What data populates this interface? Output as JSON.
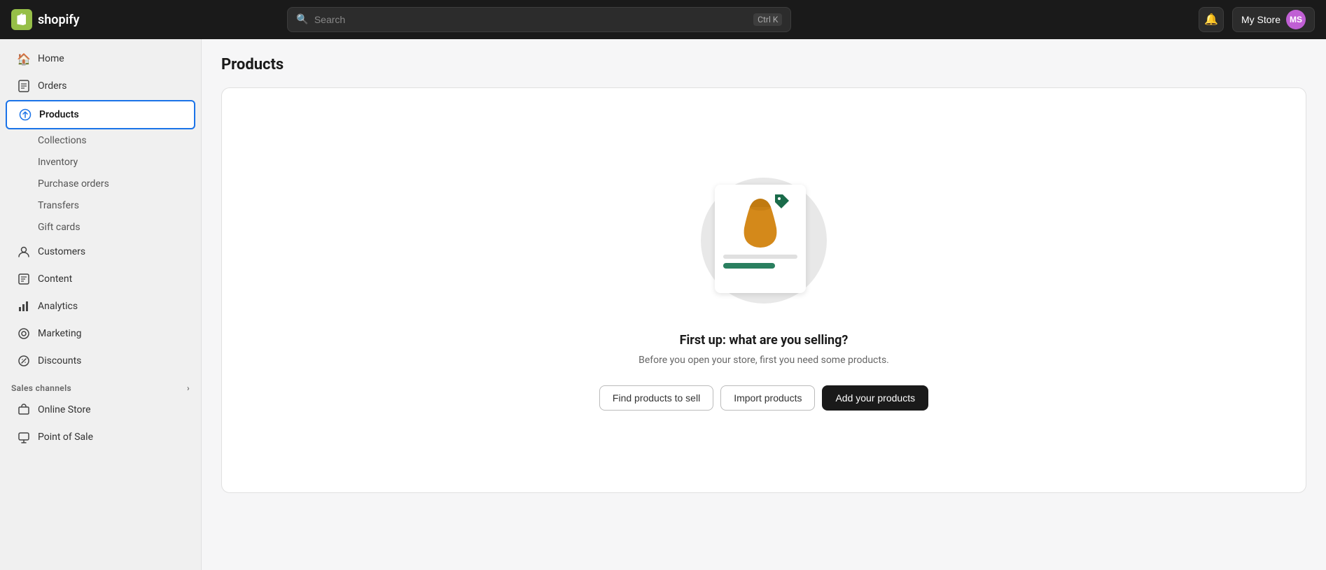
{
  "topnav": {
    "logo_text": "shopify",
    "search_placeholder": "Search",
    "search_shortcut": "Ctrl K",
    "bell_icon": "🔔",
    "store_name": "My Store",
    "avatar_initials": "MS"
  },
  "sidebar": {
    "nav_items": [
      {
        "id": "home",
        "label": "Home",
        "icon": "🏠"
      },
      {
        "id": "orders",
        "label": "Orders",
        "icon": "📋"
      },
      {
        "id": "products",
        "label": "Products",
        "icon": "🏷",
        "active": true
      }
    ],
    "sub_items": [
      {
        "id": "collections",
        "label": "Collections"
      },
      {
        "id": "inventory",
        "label": "Inventory"
      },
      {
        "id": "purchase-orders",
        "label": "Purchase orders"
      },
      {
        "id": "transfers",
        "label": "Transfers"
      },
      {
        "id": "gift-cards",
        "label": "Gift cards"
      }
    ],
    "more_items": [
      {
        "id": "customers",
        "label": "Customers",
        "icon": "👤"
      },
      {
        "id": "content",
        "label": "Content",
        "icon": "📄"
      },
      {
        "id": "analytics",
        "label": "Analytics",
        "icon": "📊"
      },
      {
        "id": "marketing",
        "label": "Marketing",
        "icon": "🎯"
      },
      {
        "id": "discounts",
        "label": "Discounts",
        "icon": "🏷"
      }
    ],
    "sales_channels_label": "Sales channels",
    "sales_channels_items": [
      {
        "id": "online-store",
        "label": "Online Store",
        "icon": "🖥"
      },
      {
        "id": "point-of-sale",
        "label": "Point of Sale",
        "icon": "💳"
      }
    ]
  },
  "main": {
    "page_title": "Products",
    "empty_state": {
      "title": "First up: what are you selling?",
      "subtitle": "Before you open your store, first you need some products.",
      "btn_find": "Find products to sell",
      "btn_import": "Import products",
      "btn_add": "Add your products"
    }
  }
}
